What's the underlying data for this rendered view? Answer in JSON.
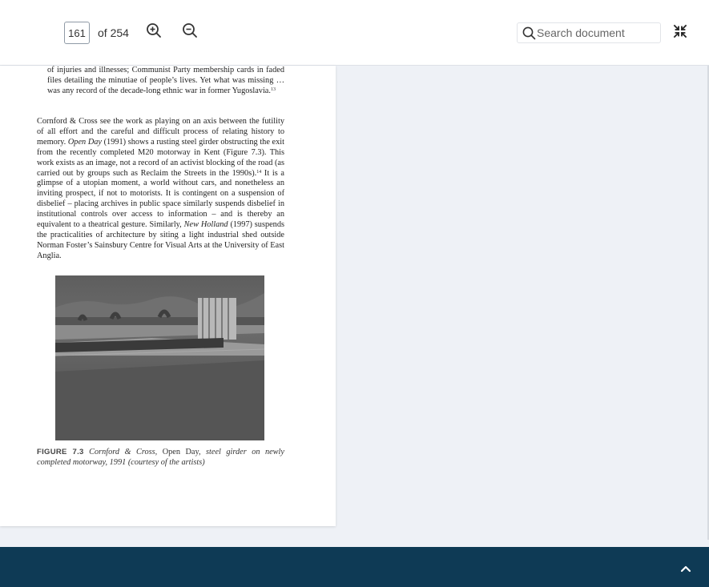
{
  "toolbar": {
    "page_number": "161",
    "page_total": "of 254",
    "zoom_in_icon": "zoom-in-icon",
    "zoom_out_icon": "zoom-out-icon",
    "search_placeholder": "Search document",
    "collapse_icon": "collapse-icon"
  },
  "document": {
    "quote_text": "of injuries and illnesses; Communist Party membership cards in faded files detailing the minutiae of people’s lives. Yet what was missing … was any record of the decade-long ethnic war in former Yugoslavia.",
    "quote_note": "13",
    "para_part1": "Cornford & Cross see the work as playing on an axis between the futility of all effort and the careful and difficult process of relating history to memory. ",
    "para_title1": "Open Day",
    "para_part2": " (1991) shows a rusting steel girder obstructing the exit from the recently completed M20 motorway in Kent (Figure 7.3). This work exists as an image, not a record of an activist blocking of the road (as carried out by groups such as Reclaim the Streets in the 1990s).",
    "para_note": "14",
    "para_part3": " It is a glimpse of a utopian moment, a world without cars, and nonetheless an inviting prospect, if not to motorists. It is contingent on a suspension of disbelief – placing archives in public space similarly suspends disbelief in institutional controls over access to information – and is thereby an equivalent to a theatrical gesture. Similarly, ",
    "para_title2": "New Holland",
    "para_part4": " (1997) suspends the practicalities of architecture by siting a light industrial shed outside Norman Foster’s Sainsbury Centre for Visual Arts at the University of East Anglia.",
    "figure_label": "FIGURE 7.3",
    "caption_part1": " Cornford & Cross, ",
    "caption_title": "Open Day,",
    "caption_part2": " steel girder on newly completed motorway, 1991 (courtesy of the artists)"
  },
  "footer": {
    "scroll_top_icon": "chevron-up-icon",
    "background": "#0e3a55"
  }
}
